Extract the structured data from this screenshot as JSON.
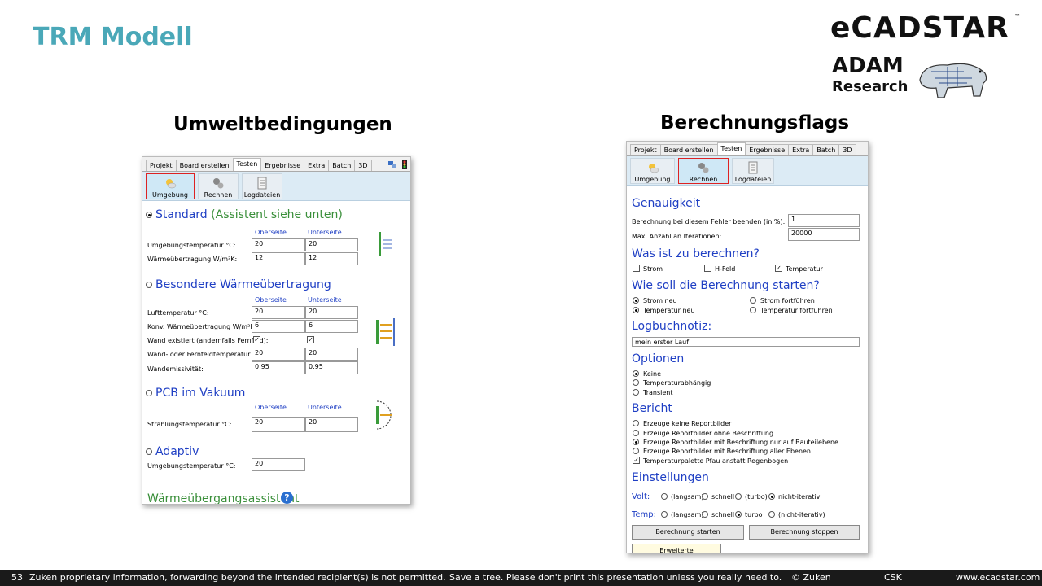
{
  "slide": {
    "title": "TRM Modell",
    "left_section": "Umweltbedingungen",
    "right_section": "Berechnungsflags",
    "logo": {
      "brand": "eCADSTAR",
      "tm": "™",
      "partner": "ADAM",
      "partner2": "Research"
    }
  },
  "tabs": [
    "Projekt",
    "Board erstellen",
    "Testen",
    "Ergebnisse",
    "Extra",
    "Batch",
    "3D"
  ],
  "ribbon": {
    "umgebung": "Umgebung",
    "rechnen": "Rechnen",
    "logdateien": "Logdateien"
  },
  "left": {
    "standard": {
      "title": "Standard",
      "hint": "(Assistent siehe unten)",
      "col1": "Oberseite",
      "col2": "Unterseite",
      "rows": [
        {
          "label": "Umgebungstemperatur °C:",
          "v1": "20",
          "v2": "20"
        },
        {
          "label": "Wärmeübertragung W/m²K:",
          "v1": "12",
          "v2": "12"
        }
      ]
    },
    "besondere": {
      "title": "Besondere Wärmeübertragung",
      "col1": "Oberseite",
      "col2": "Unterseite",
      "rows": [
        {
          "label": "Lufttemperatur °C:",
          "v1": "20",
          "v2": "20"
        },
        {
          "label": "Konv. Wärmeübertragung W/m²K:",
          "v1": "6",
          "v2": "6"
        },
        {
          "label": "Wand existiert (andernfalls Fernfeld):"
        },
        {
          "label": "Wand- oder Fernfeldtemperatur °C:",
          "v1": "20",
          "v2": "20"
        },
        {
          "label": "Wandemissivität:",
          "v1": "0.95",
          "v2": "0.95"
        }
      ]
    },
    "vakuum": {
      "title": "PCB im Vakuum",
      "col1": "Oberseite",
      "col2": "Unterseite",
      "label": "Strahlungstemperatur °C:",
      "v1": "20",
      "v2": "20"
    },
    "adaptiv": {
      "title": "Adaptiv",
      "label": "Umgebungstemperatur °C:",
      "v1": "20"
    },
    "assistent": "Wärmeübergangsassistent",
    "help": "?"
  },
  "right": {
    "genauigkeit": {
      "title": "Genauigkeit",
      "l1": "Berechnung bei diesem Fehler beenden (in %):",
      "v1": "1",
      "l2": "Max. Anzahl an Iterationen:",
      "v2": "20000"
    },
    "was": {
      "title": "Was ist zu berechnen?",
      "o1": "Strom",
      "o2": "H-Feld",
      "o3": "Temperatur"
    },
    "wie": {
      "title": "Wie soll die Berechnung starten?",
      "o1": "Strom neu",
      "o2": "Strom fortführen",
      "o3": "Temperatur neu",
      "o4": "Temperatur fortführen"
    },
    "log": {
      "title": "Logbuchnotiz:",
      "value": "mein erster Lauf"
    },
    "optionen": {
      "title": "Optionen",
      "o1": "Keine",
      "o2": "Temperaturabhängig",
      "o3": "Transient"
    },
    "bericht": {
      "title": "Bericht",
      "o1": "Erzeuge keine Reportbilder",
      "o2": "Erzeuge Reportbilder ohne Beschriftung",
      "o3": "Erzeuge Reportbilder mit Beschriftung nur auf Bauteilebene",
      "o4": "Erzeuge Reportbilder mit Beschriftung aller Ebenen",
      "o5": "Temperaturpalette Pfau anstatt Regenbogen"
    },
    "einstellungen": {
      "title": "Einstellungen",
      "volt": "Volt:",
      "temp": "Temp:",
      "langsam": "(langsam)",
      "schnell": "schnell",
      "turbo_p": "(turbo)",
      "turbo": "turbo",
      "nicht": "nicht-iterativ",
      "nicht_p": "(nicht-iterativ)"
    },
    "start": "Berechnung starten",
    "stop": "Berechnung stoppen",
    "erweitert": "Erweiterte Berechnungsoptionen"
  },
  "footer": {
    "page": "53",
    "notice": "Zuken proprietary information, forwarding beyond the intended recipient(s) is not permitted.",
    "tree": "Save a tree. Please don't print this presentation unless you really need to.",
    "copy": "© Zuken",
    "csk": "CSK",
    "url": "www.ecadstar.com"
  }
}
